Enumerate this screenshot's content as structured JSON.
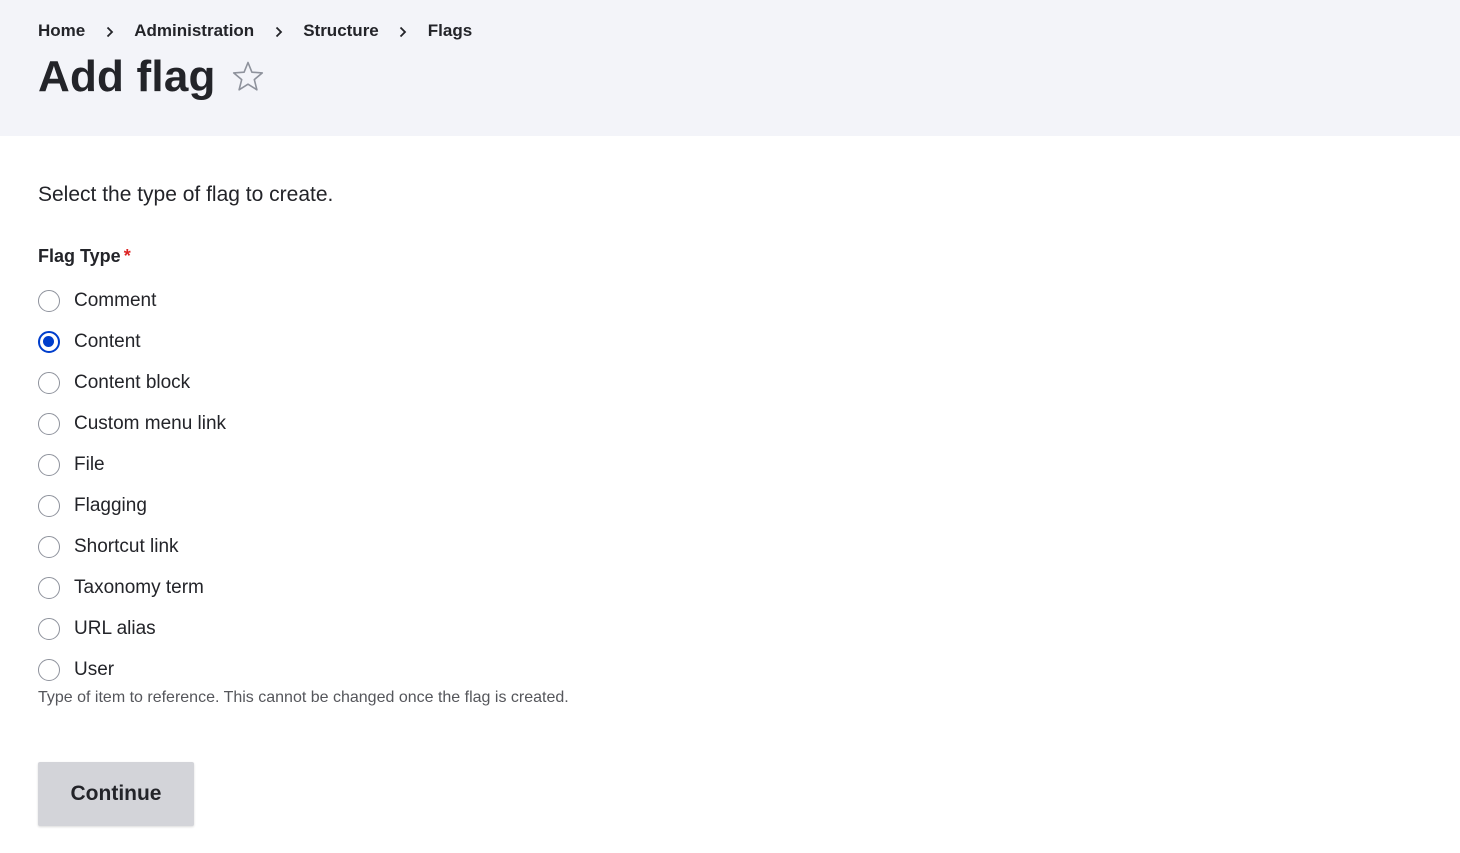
{
  "breadcrumb": [
    {
      "label": "Home"
    },
    {
      "label": "Administration"
    },
    {
      "label": "Structure"
    },
    {
      "label": "Flags"
    }
  ],
  "page": {
    "title": "Add flag",
    "favorite_icon": "star-outline-icon"
  },
  "form": {
    "intro": "Select the type of flag to create.",
    "field_label": "Flag Type",
    "required_marker": "*",
    "options": [
      {
        "label": "Comment",
        "checked": false
      },
      {
        "label": "Content",
        "checked": true
      },
      {
        "label": "Content block",
        "checked": false
      },
      {
        "label": "Custom menu link",
        "checked": false
      },
      {
        "label": "File",
        "checked": false
      },
      {
        "label": "Flagging",
        "checked": false
      },
      {
        "label": "Shortcut link",
        "checked": false
      },
      {
        "label": "Taxonomy term",
        "checked": false
      },
      {
        "label": "URL alias",
        "checked": false
      },
      {
        "label": "User",
        "checked": false
      }
    ],
    "description": "Type of item to reference. This cannot be changed once the flag is created.",
    "submit_label": "Continue"
  },
  "colors": {
    "header_bg": "#f3f4f9",
    "accent": "#003ecc",
    "required": "#dc2323",
    "button_bg": "#d3d4d9"
  }
}
